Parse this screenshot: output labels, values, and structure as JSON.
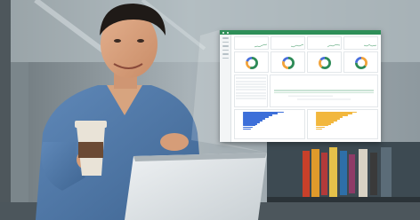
{
  "scene": {
    "description_free": true
  },
  "dashboard": {
    "kpi_count": 4,
    "donut_colors": [
      [
        "#2e8b57",
        "#f2a33a",
        "#4a6fdc"
      ],
      [
        "#2e8b57",
        "#f2a33a",
        "#4a6fdc"
      ],
      [
        "#2e8b57",
        "#f2a33a",
        "#4a6fdc"
      ],
      [
        "#f2a33a",
        "#2e8b57",
        "#4a6fdc"
      ]
    ],
    "donut_fractions": [
      [
        0.55,
        0.25,
        0.2
      ],
      [
        0.5,
        0.3,
        0.2
      ],
      [
        0.6,
        0.25,
        0.15
      ],
      [
        0.35,
        0.4,
        0.25
      ]
    ],
    "left_bar_color": "#3d6fd9",
    "right_bar_color": "#f2b73d",
    "left_bars": [
      1.0,
      0.85,
      0.72,
      0.64,
      0.55,
      0.48,
      0.42,
      0.36,
      0.3,
      0.25,
      0.2
    ],
    "right_bars": [
      1.0,
      0.9,
      0.78,
      0.66,
      0.6,
      0.52,
      0.44,
      0.38,
      0.3,
      0.22,
      0.16
    ],
    "accent": "#2f8f58"
  }
}
